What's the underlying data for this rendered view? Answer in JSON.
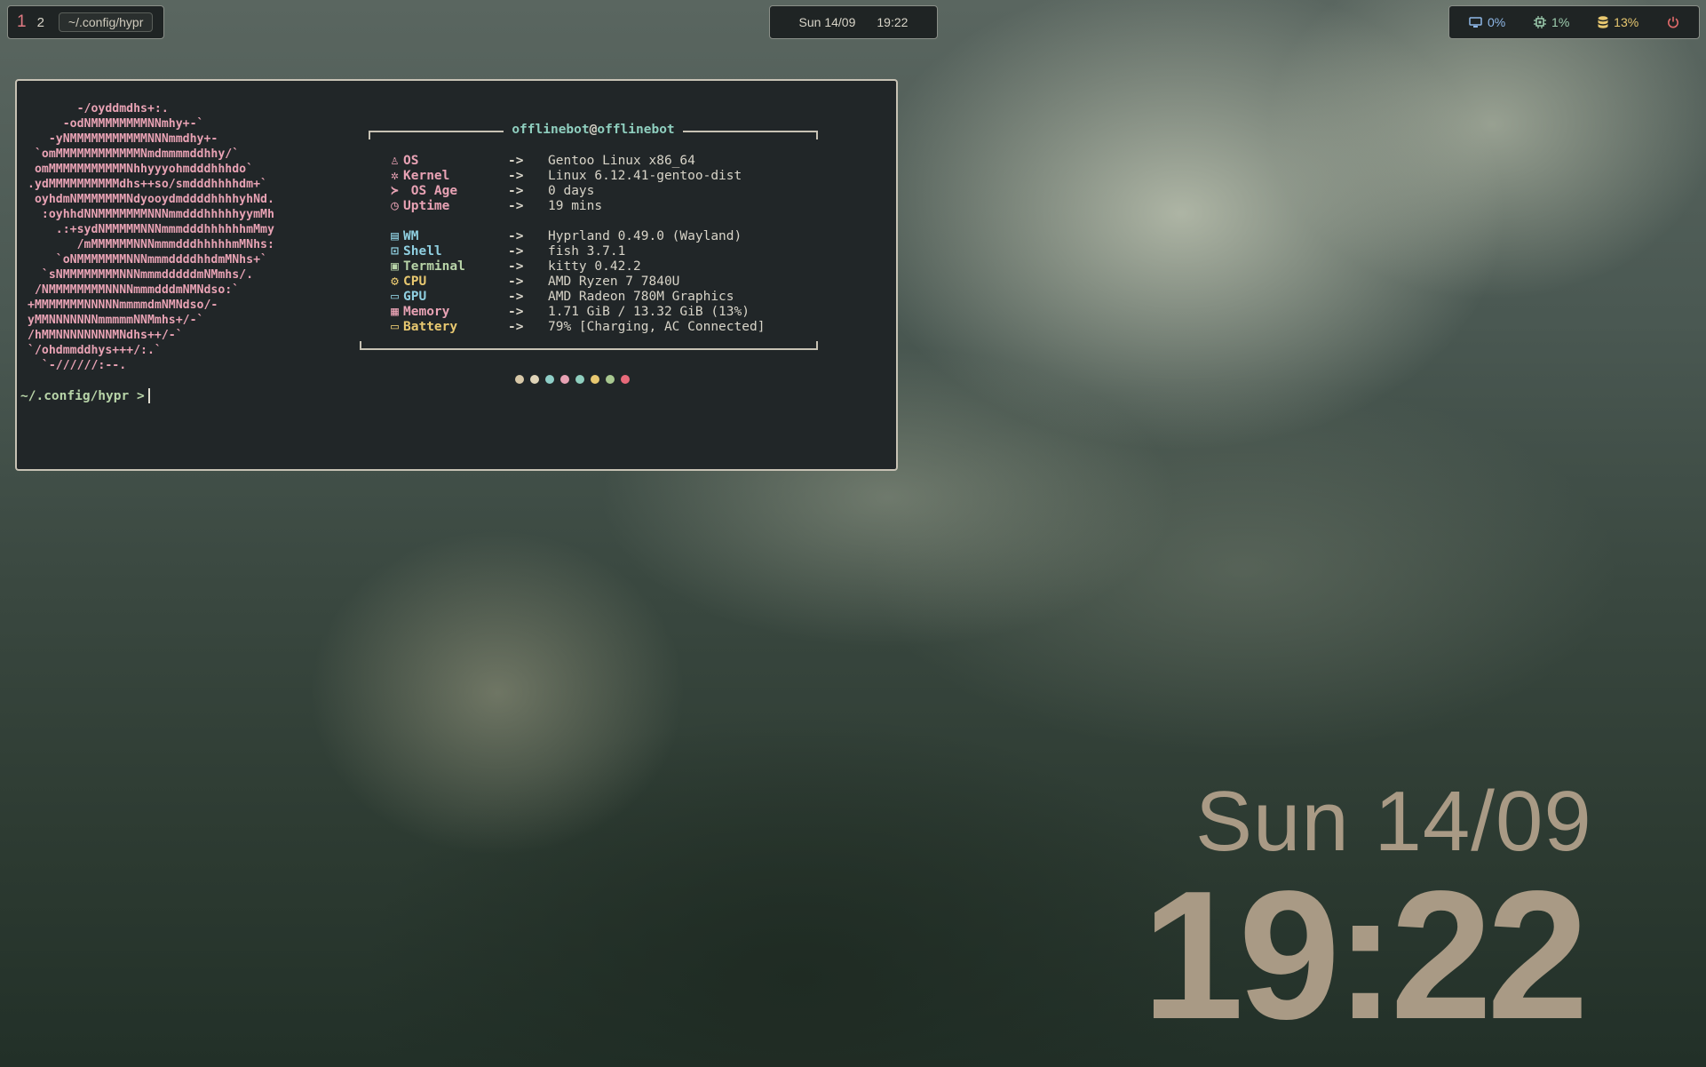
{
  "topbar": {
    "workspaces": [
      {
        "label": "1",
        "active": true
      },
      {
        "label": "2",
        "active": false
      }
    ],
    "window_path": "~/.config/hypr",
    "clock": {
      "date": "Sun 14/09",
      "time": "19:22"
    },
    "stats": [
      {
        "icon": "monitor-icon",
        "value": "0%",
        "color": "#8fb8e8"
      },
      {
        "icon": "cpu-icon",
        "value": "1%",
        "color": "#9fcfb0"
      },
      {
        "icon": "database-icon",
        "value": "13%",
        "color": "#e8c870"
      }
    ],
    "power_icon": "power-icon",
    "power_color": "#e06a6a"
  },
  "terminal": {
    "ascii_art": [
      "       -/oyddmdhs+:.",
      "     -odNMMMMMMMMNNmhy+-`",
      "   -yNMMMMMMMMMMMNNNmmdhy+-",
      " `omMMMMMMMMMMMMNmdmmmmddhhy/`",
      " omMMMMMMMMMMMNhhyyyohmdddhhhdo`",
      ".ydMMMMMMMMMMdhs++so/smdddhhhhdm+`",
      " oyhdmNMMMMMMMNdyooydmddddhhhhyhNd.",
      "  :oyhhdNNMMMMMMMNNNmmdddhhhhhyymMh",
      "    .:+sydNMMMMMNNNmmmdddhhhhhhmMmy",
      "       /mMMMMMMNNNmmmdddhhhhhmMNhs:",
      "    `oNMMMMMMMNNNmmmddddhhdmMNhs+`",
      "  `sNMMMMMMMMNNNmmmdddddmNMmhs/.",
      " /NMMMMMMMMNNNNmmmdddmNMNdso:`",
      "+MMMMMMMNNNNNmmmmdmNMNdso/-",
      "yMMNNNNNNNmmmmmNNMmhs+/-`",
      "/hMMNNNNNNNNMNdhs++/-`",
      "`/ohdmmddhys+++/:.`",
      "  `-//////:--."
    ],
    "user": "offlinebot",
    "at": "@",
    "host": "offlinebot",
    "arrow": "->",
    "info_group1": [
      {
        "icon": "linux-icon",
        "glyph": "♙",
        "key": "OS",
        "value": "Gentoo Linux x86_64",
        "color": "#e8a2b4"
      },
      {
        "icon": "gear-icon",
        "glyph": "✲",
        "key": "Kernel",
        "value": "Linux 6.12.41-gentoo-dist",
        "color": "#e8a2b4"
      },
      {
        "icon": "terminal-prompt-icon",
        "glyph": "≻",
        "key": " OS Age",
        "value": "0 days",
        "color": "#e8a2b4"
      },
      {
        "icon": "clock-icon",
        "glyph": "◷",
        "key": "Uptime",
        "value": "19 mins",
        "color": "#e8a2b4"
      }
    ],
    "info_group2": [
      {
        "icon": "window-icon",
        "glyph": "▤",
        "key": "WM",
        "value": "Hyprland 0.49.0 (Wayland)",
        "color": "#8fcfe0"
      },
      {
        "icon": "shell-icon",
        "glyph": "⊡",
        "key": "Shell",
        "value": "fish 3.7.1",
        "color": "#8fcfe0"
      },
      {
        "icon": "terminal-icon",
        "glyph": "▣",
        "key": "Terminal",
        "value": "kitty 0.42.2",
        "color": "#b8d4a8"
      },
      {
        "icon": "cpu-icon",
        "glyph": "⚙",
        "key": "CPU",
        "value": "AMD Ryzen 7 7840U",
        "color": "#e8c870"
      },
      {
        "icon": "gpu-icon",
        "glyph": "▭",
        "key": "GPU",
        "value": "AMD Radeon 780M Graphics",
        "color": "#8fcfe0"
      },
      {
        "icon": "memory-icon",
        "glyph": "▦",
        "key": "Memory",
        "value": "1.71 GiB / 13.32 GiB (13%)",
        "color": "#e8a2b4"
      },
      {
        "icon": "battery-icon",
        "glyph": "▭",
        "key": "Battery",
        "value": "79% [Charging, AC Connected]",
        "color": "#e8c870"
      }
    ],
    "palette": [
      "#d8c8a8",
      "#e0d4b8",
      "#8fcfc8",
      "#e8a2b4",
      "#8fcfbf",
      "#e8c870",
      "#a8c890",
      "#e86a7a"
    ],
    "prompt": "~/.config/hypr >"
  },
  "desktop_clock": {
    "date": "Sun 14/09",
    "time": "19:22"
  }
}
